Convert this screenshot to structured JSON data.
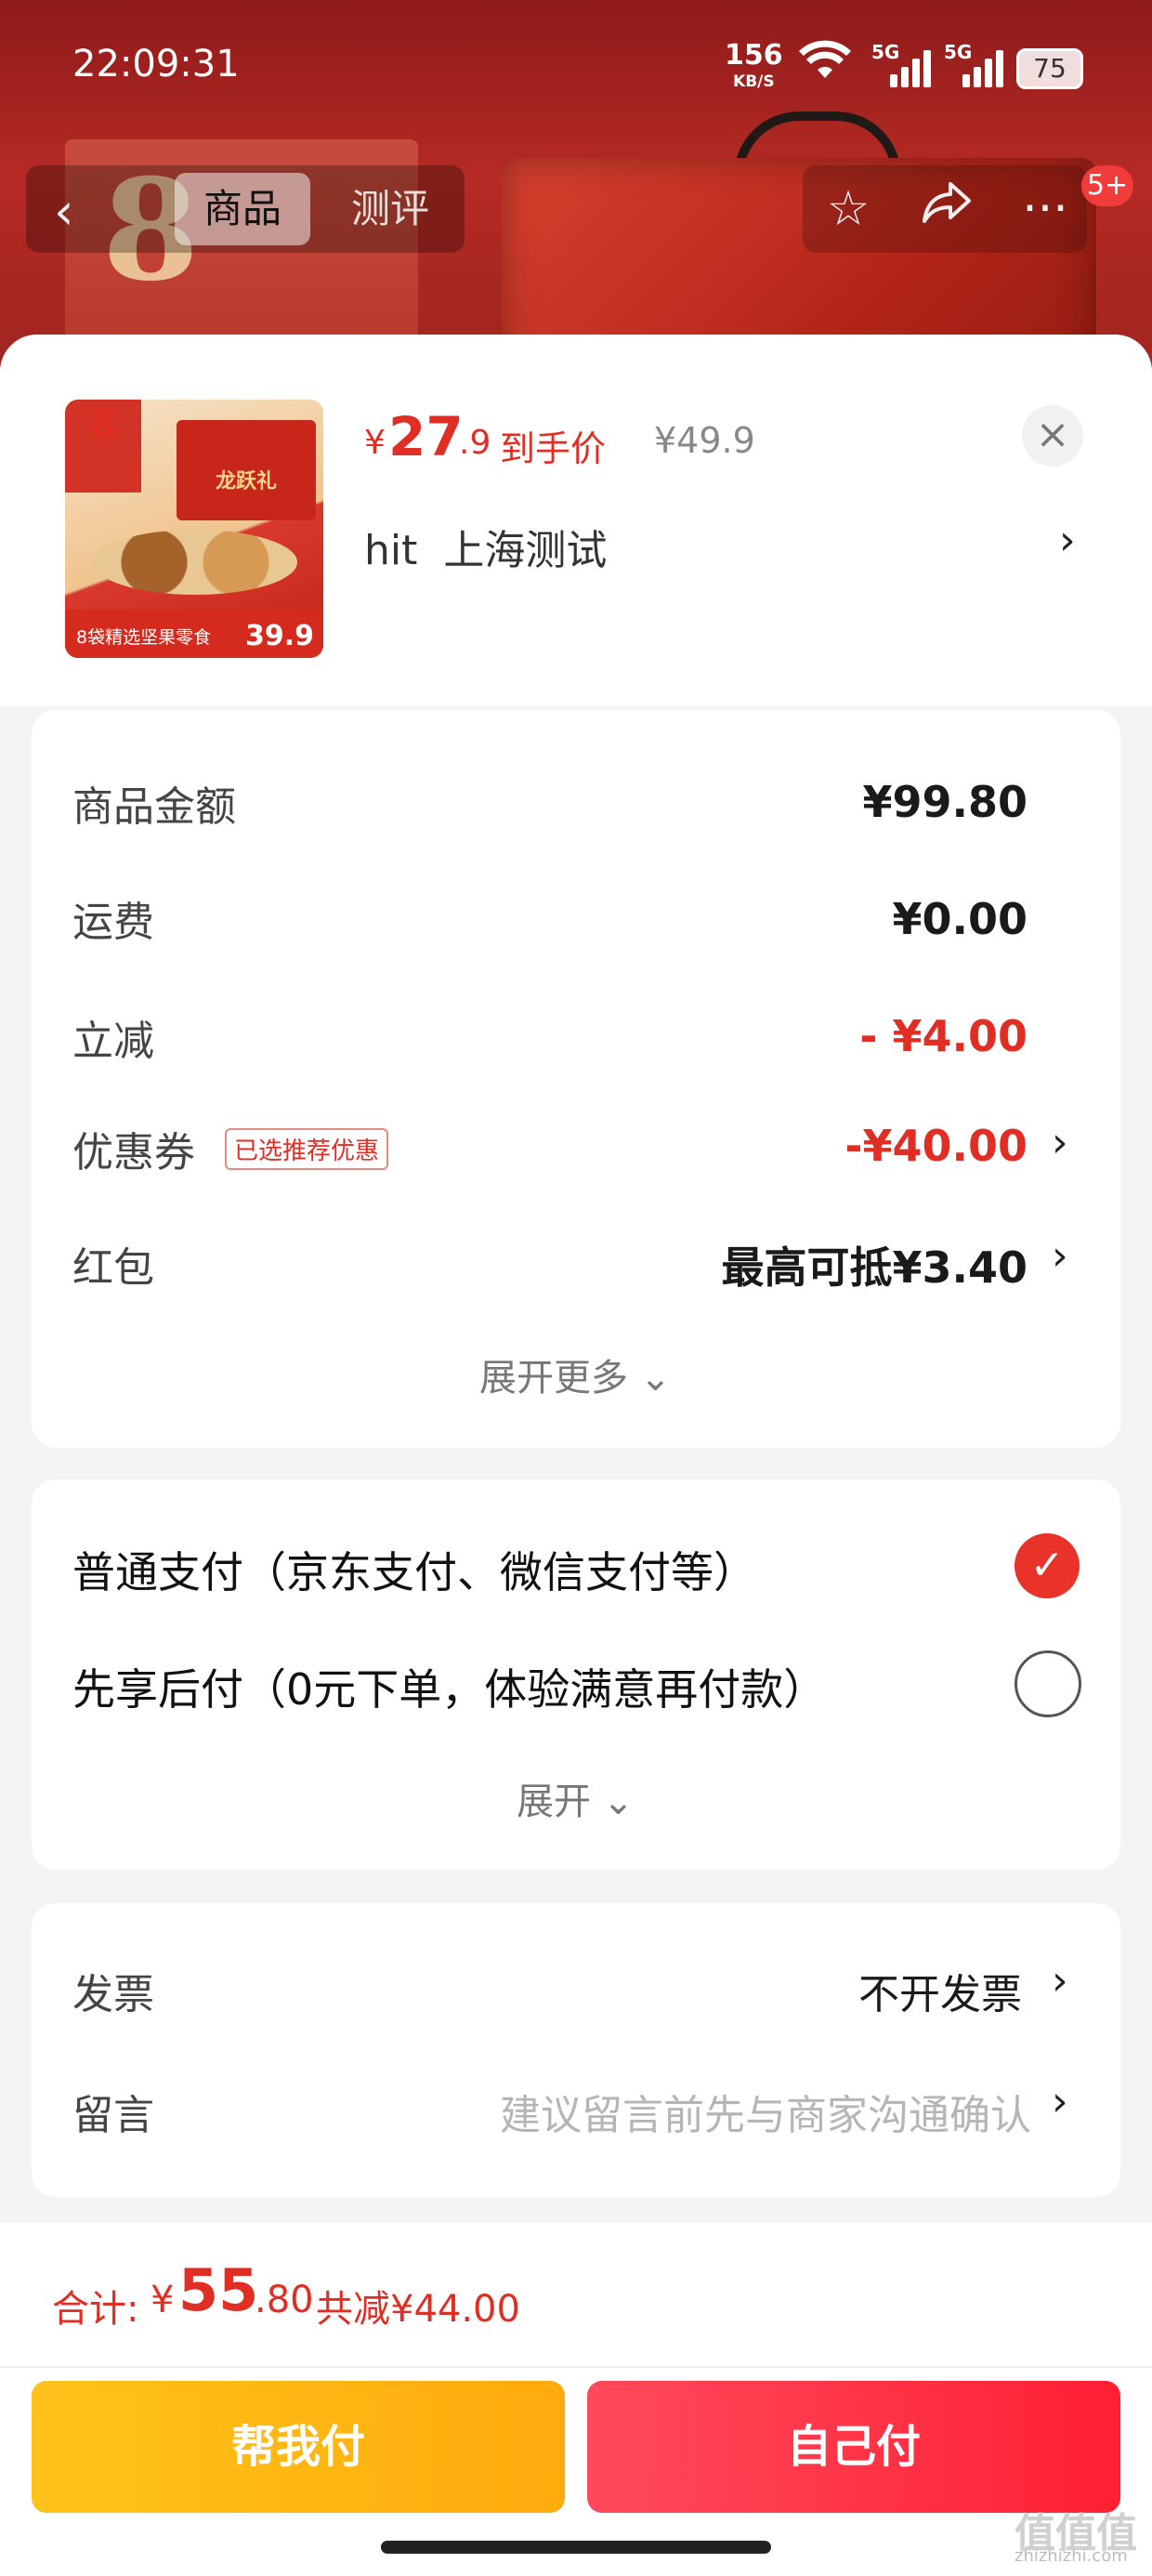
{
  "status_bar": {
    "time": "22:09:31",
    "net_speed": "156",
    "net_unit": "KB/S",
    "sim1": "5G",
    "sim2": "5G",
    "battery": "75"
  },
  "nav": {
    "tabs": [
      {
        "label": "商品",
        "active": true
      },
      {
        "label": "测评",
        "active": false
      }
    ],
    "badge": "5+",
    "icons": [
      "back-icon",
      "star-icon",
      "share-icon",
      "more-icon"
    ]
  },
  "product": {
    "price_currency": "¥",
    "price_int": "27",
    "price_dec": ".9",
    "price_tag": "到手价",
    "original_price": "¥49.9",
    "shop": "hit  上海测试",
    "thumb": {
      "badge": "8",
      "box_text": "龙跃礼",
      "bottom_label": "8袋精选坚果零食",
      "price": "39.9"
    }
  },
  "summary": {
    "rows": [
      {
        "label": "商品金额",
        "value": "¥99.80"
      },
      {
        "label": "运费",
        "value": "¥0.00"
      },
      {
        "label": "立减",
        "value": "- ¥4.00"
      },
      {
        "label": "优惠券",
        "value": "-¥40.00",
        "tag": "已选推荐优惠"
      },
      {
        "label": "红包",
        "value": "最高可抵¥3.40"
      }
    ],
    "expand": "展开更多"
  },
  "payment": {
    "options": [
      {
        "label": "普通支付（京东支付、微信支付等）",
        "selected": true
      },
      {
        "label": "先享后付（0元下单，体验满意再付款）",
        "selected": false
      }
    ],
    "expand": "展开"
  },
  "extra": {
    "invoice_label": "发票",
    "invoice_value": "不开发票",
    "note_label": "留言",
    "note_placeholder": "建议留言前先与商家沟通确认"
  },
  "footer": {
    "total_label": "合计:",
    "total_currency": "¥",
    "total_int": "55",
    "total_dec": ".80",
    "total_saved": "共减¥44.00",
    "help_pay": "帮我付",
    "self_pay": "自己付"
  },
  "watermark": {
    "text": "值值值",
    "url": "zhizhizhi.com"
  },
  "colors": {
    "accent_red": "#e02e24",
    "pay_yellow": "#ffb512",
    "pay_red": "#ff2f41"
  }
}
